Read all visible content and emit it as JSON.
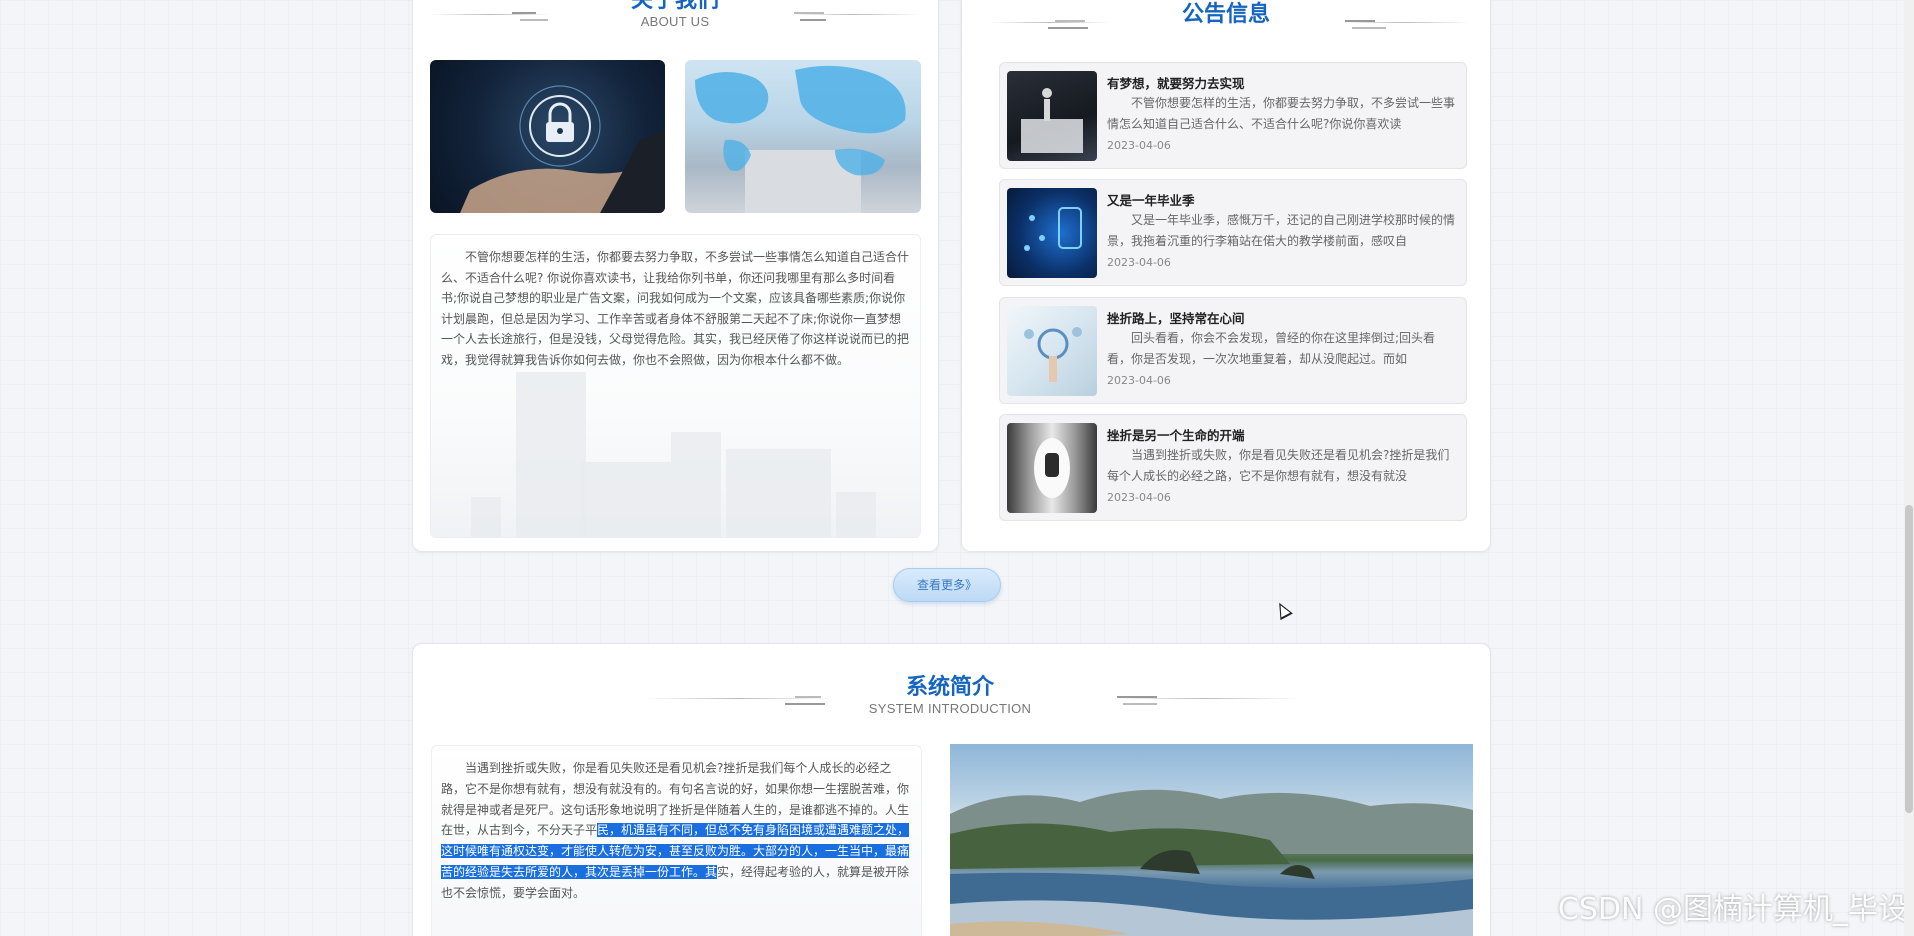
{
  "about": {
    "title": "关于我们",
    "subtitle": "ABOUT US",
    "text": "不管你想要怎样的生活，你都要去努力争取，不多尝试一些事情怎么知道自己适合什么、不适合什么呢? 你说你喜欢读书，让我给你列书单，你还问我哪里有那么多时间看书;你说自己梦想的职业是广告文案，问我如何成为一个文案，应该具备哪些素质;你说你计划晨跑，但总是因为学习、工作辛苦或者身体不舒服第二天起不了床;你说你一直梦想一个人去长途旅行，但是没钱，父母觉得危险。其实，我已经厌倦了你这样说说而已的把戏，我觉得就算我告诉你如何去做，你也不会照做，因为你根本什么都不做。"
  },
  "notices": {
    "title": "公告信息",
    "items": [
      {
        "title": "有梦想，就要努力去实现",
        "desc": "不管你想要怎样的生活，你都要去努力争取，不多尝试一些事情怎么知道自己适合什么、不适合什么呢?你说你喜欢读",
        "date": "2023-04-06"
      },
      {
        "title": "又是一年毕业季",
        "desc": "又是一年毕业季，感慨万千，还记的自己刚进学校那时候的情景，我拖着沉重的行李箱站在偌大的教学楼前面，感叹自",
        "date": "2023-04-06"
      },
      {
        "title": "挫折路上，坚持常在心间",
        "desc": "回头看看，你会不会发现，曾经的你在这里摔倒过;回头看看，你是否发现，一次次地重复着，却从没爬起过。而如",
        "date": "2023-04-06"
      },
      {
        "title": "挫折是另一个生命的开端",
        "desc": "当遇到挫折或失败，你是看见失败还是看见机会?挫折是我们每个人成长的必经之路，它不是你想有就有，想没有就没",
        "date": "2023-04-06"
      }
    ]
  },
  "more_button": "查看更多》",
  "system": {
    "title": "系统简介",
    "subtitle": "SYSTEM INTRODUCTION",
    "text_before": "当遇到挫折或失败，你是看见失败还是看见机会?挫折是我们每个人成长的必经之路，它不是你想有就有，想没有就没有的。有句名言说的好，如果你想一生摆脱苦难，你就得是神或者是死尸。这句话形象地说明了挫折是伴随着人生的，是谁都逃不掉的。人生在世，从古到今，不分天子平",
    "text_highlight": "民，机遇虽有不同，但总不免有身陷困境或遭遇难题之处，这时候唯有通权达变，才能使人转危为安，甚至反败为胜。大部分的人，一生当中，最痛苦的经验是失去所爱的人，其次是丢掉一份工作。其",
    "text_after": "实，经得起考验的人，就算是被开除也不会惊慌，要学会面对。"
  },
  "watermark": "CSDN @图楠计算机_毕设"
}
